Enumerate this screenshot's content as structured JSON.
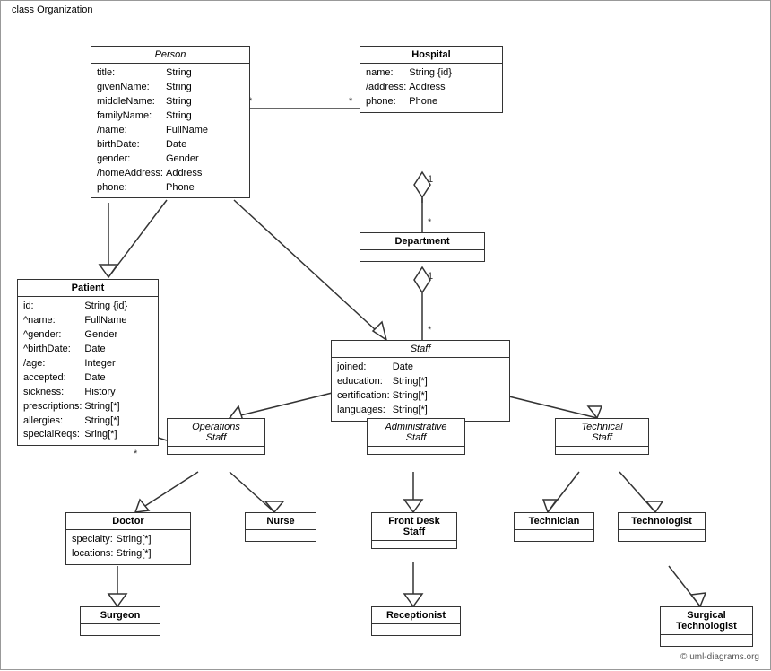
{
  "diagram_title": "class Organization",
  "copyright": "© uml-diagrams.org",
  "classes": {
    "person": {
      "name": "Person",
      "italic": true,
      "attrs": [
        [
          "title:",
          "String"
        ],
        [
          "givenName:",
          "String"
        ],
        [
          "middleName:",
          "String"
        ],
        [
          "familyName:",
          "String"
        ],
        [
          "/name:",
          "FullName"
        ],
        [
          "birthDate:",
          "Date"
        ],
        [
          "gender:",
          "Gender"
        ],
        [
          "/homeAddress:",
          "Address"
        ],
        [
          "phone:",
          "Phone"
        ]
      ]
    },
    "hospital": {
      "name": "Hospital",
      "italic": false,
      "bold": true,
      "attrs": [
        [
          "name:",
          "String {id}"
        ],
        [
          "/address:",
          "Address"
        ],
        [
          "phone:",
          "Phone"
        ]
      ]
    },
    "patient": {
      "name": "Patient",
      "italic": false,
      "bold": true,
      "attrs": [
        [
          "id:",
          "String {id}"
        ],
        [
          "^name:",
          "FullName"
        ],
        [
          "^gender:",
          "Gender"
        ],
        [
          "^birthDate:",
          "Date"
        ],
        [
          "/age:",
          "Integer"
        ],
        [
          "accepted:",
          "Date"
        ],
        [
          "sickness:",
          "History"
        ],
        [
          "prescriptions:",
          "String[*]"
        ],
        [
          "allergies:",
          "String[*]"
        ],
        [
          "specialReqs:",
          "Sring[*]"
        ]
      ]
    },
    "department": {
      "name": "Department",
      "italic": false,
      "bold": true,
      "attrs": []
    },
    "staff": {
      "name": "Staff",
      "italic": true,
      "attrs": [
        [
          "joined:",
          "Date"
        ],
        [
          "education:",
          "String[*]"
        ],
        [
          "certification:",
          "String[*]"
        ],
        [
          "languages:",
          "String[*]"
        ]
      ]
    },
    "operations_staff": {
      "name": "Operations\nStaff",
      "italic": true,
      "attrs": []
    },
    "administrative_staff": {
      "name": "Administrative\nStaff",
      "italic": true,
      "attrs": []
    },
    "technical_staff": {
      "name": "Technical\nStaff",
      "italic": true,
      "attrs": []
    },
    "doctor": {
      "name": "Doctor",
      "italic": false,
      "bold": true,
      "attrs": [
        [
          "specialty:",
          "String[*]"
        ],
        [
          "locations:",
          "String[*]"
        ]
      ]
    },
    "nurse": {
      "name": "Nurse",
      "italic": false,
      "bold": true,
      "attrs": []
    },
    "front_desk_staff": {
      "name": "Front Desk\nStaff",
      "italic": false,
      "bold": true,
      "attrs": []
    },
    "technician": {
      "name": "Technician",
      "italic": false,
      "bold": true,
      "attrs": []
    },
    "technologist": {
      "name": "Technologist",
      "italic": false,
      "bold": true,
      "attrs": []
    },
    "surgeon": {
      "name": "Surgeon",
      "italic": false,
      "bold": true,
      "attrs": []
    },
    "receptionist": {
      "name": "Receptionist",
      "italic": false,
      "bold": true,
      "attrs": []
    },
    "surgical_technologist": {
      "name": "Surgical\nTechnologist",
      "italic": false,
      "bold": true,
      "attrs": []
    }
  },
  "multiplicity": {
    "person_hospital_star1": "*",
    "person_hospital_star2": "*",
    "hospital_dept_1": "1",
    "hospital_dept_star": "*",
    "dept_staff_1": "1",
    "dept_staff_star": "*",
    "patient_star": "*",
    "ops_star": "*"
  }
}
